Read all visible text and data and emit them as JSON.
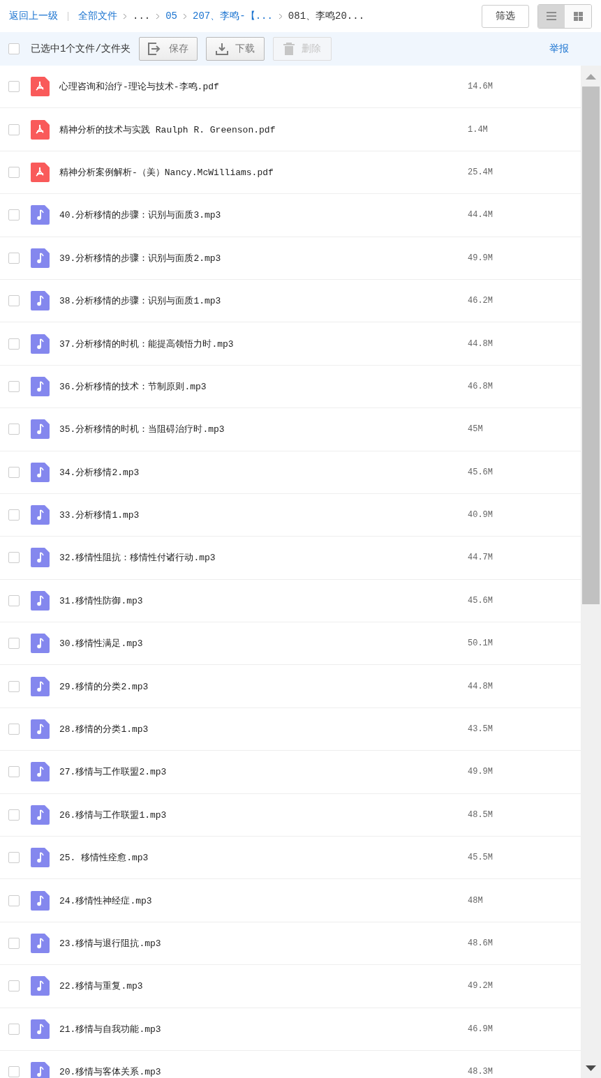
{
  "breadcrumb": {
    "back": "返回上一级",
    "items": [
      {
        "label": "全部文件",
        "link": true
      },
      {
        "label": "...",
        "link": false
      },
      {
        "label": "05",
        "link": true
      },
      {
        "label": "207、李鸣-【...",
        "link": true
      },
      {
        "label": "081、李鸣20...",
        "link": false
      }
    ]
  },
  "filter_button": "筛选",
  "view_modes": [
    {
      "kind": "list",
      "selected": true
    },
    {
      "kind": "grid",
      "selected": false
    }
  ],
  "toolbar": {
    "select_all_checked": false,
    "selection_text": "已选中1个文件/文件夹",
    "buttons": [
      {
        "kind": "save",
        "label": "保存",
        "disabled": false
      },
      {
        "kind": "download",
        "label": "下载",
        "disabled": false
      },
      {
        "kind": "delete",
        "label": "删除",
        "disabled": true
      }
    ],
    "report_link": "举报"
  },
  "files": [
    {
      "kind": "pdf",
      "name": "心理咨询和治疗-理论与技术-李鸣.pdf",
      "size": "14.6M",
      "checked": false
    },
    {
      "kind": "pdf",
      "name": "精神分析的技术与实践 Raulph R. Greenson.pdf",
      "size": "1.4M",
      "checked": false
    },
    {
      "kind": "pdf",
      "name": "精神分析案例解析-（美）Nancy.McWilliams.pdf",
      "size": "25.4M",
      "checked": false
    },
    {
      "kind": "audio",
      "name": "40.分析移情的步骤：识别与面质3.mp3",
      "size": "44.4M",
      "checked": false
    },
    {
      "kind": "audio",
      "name": "39.分析移情的步骤：识别与面质2.mp3",
      "size": "49.9M",
      "checked": false
    },
    {
      "kind": "audio",
      "name": "38.分析移情的步骤：识别与面质1.mp3",
      "size": "46.2M",
      "checked": false
    },
    {
      "kind": "audio",
      "name": "37.分析移情的时机：能提高领悟力时.mp3",
      "size": "44.8M",
      "checked": false
    },
    {
      "kind": "audio",
      "name": "36.分析移情的技术：节制原则.mp3",
      "size": "46.8M",
      "checked": false
    },
    {
      "kind": "audio",
      "name": "35.分析移情的时机：当阻碍治疗时.mp3",
      "size": "45M",
      "checked": false
    },
    {
      "kind": "audio",
      "name": "34.分析移情2.mp3",
      "size": "45.6M",
      "checked": false
    },
    {
      "kind": "audio",
      "name": "33.分析移情1.mp3",
      "size": "40.9M",
      "checked": false
    },
    {
      "kind": "audio",
      "name": "32.移情性阻抗：移情性付诸行动.mp3",
      "size": "44.7M",
      "checked": false
    },
    {
      "kind": "audio",
      "name": "31.移情性防御.mp3",
      "size": "45.6M",
      "checked": false
    },
    {
      "kind": "audio",
      "name": "30.移情性满足.mp3",
      "size": "50.1M",
      "checked": false
    },
    {
      "kind": "audio",
      "name": "29.移情的分类2.mp3",
      "size": "44.8M",
      "checked": false
    },
    {
      "kind": "audio",
      "name": "28.移情的分类1.mp3",
      "size": "43.5M",
      "checked": false
    },
    {
      "kind": "audio",
      "name": "27.移情与工作联盟2.mp3",
      "size": "49.9M",
      "checked": false
    },
    {
      "kind": "audio",
      "name": "26.移情与工作联盟1.mp3",
      "size": "48.5M",
      "checked": false
    },
    {
      "kind": "audio",
      "name": "25.  移情性痊愈.mp3",
      "size": "45.5M",
      "checked": false
    },
    {
      "kind": "audio",
      "name": "24.移情性神经症.mp3",
      "size": "48M",
      "checked": false
    },
    {
      "kind": "audio",
      "name": "23.移情与退行阻抗.mp3",
      "size": "48.6M",
      "checked": false
    },
    {
      "kind": "audio",
      "name": "22.移情与重复.mp3",
      "size": "49.2M",
      "checked": false
    },
    {
      "kind": "audio",
      "name": "21.移情与自我功能.mp3",
      "size": "46.9M",
      "checked": false
    },
    {
      "kind": "audio",
      "name": "20.移情与客体关系.mp3",
      "size": "48.3M",
      "checked": false
    }
  ]
}
